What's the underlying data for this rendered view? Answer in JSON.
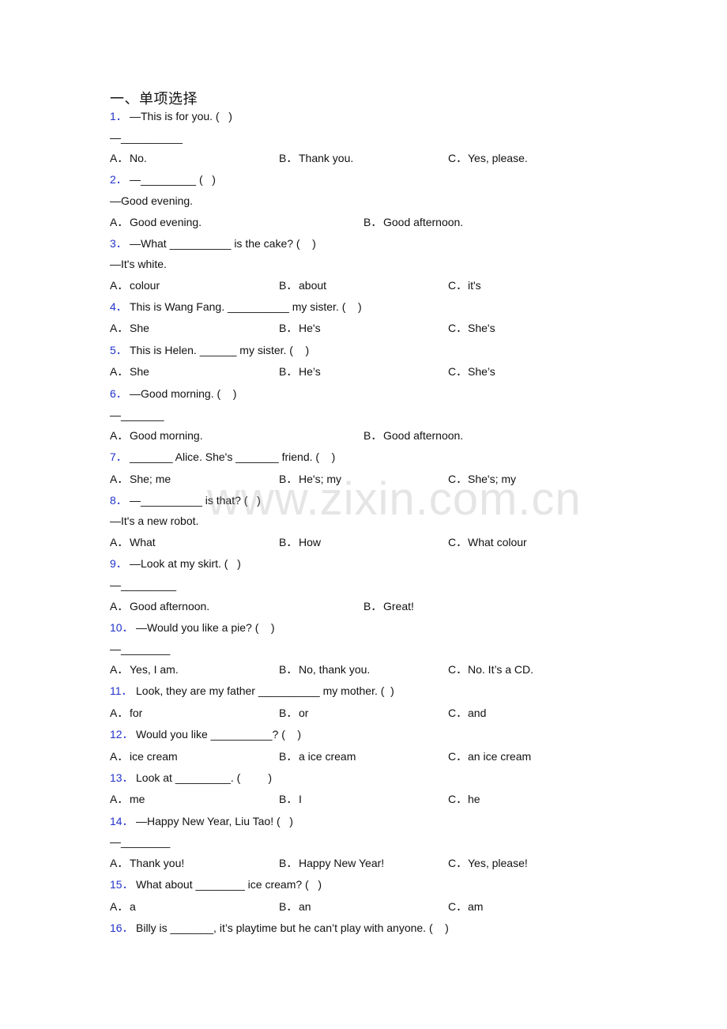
{
  "section_title": "一、单项选择",
  "watermark": "www.zixin.com.cn",
  "questions": [
    {
      "num": "1．",
      "stem": "—This is for you. (   )",
      "reply": "—__________",
      "options": [
        {
          "letter": "A．",
          "text": "No."
        },
        {
          "letter": "B．",
          "text": "Thank you."
        },
        {
          "letter": "C．",
          "text": "Yes, please."
        }
      ]
    },
    {
      "num": "2．",
      "stem": "—_________ (   )",
      "reply": "—Good evening.",
      "options": [
        {
          "letter": "A．",
          "text": "Good evening."
        },
        {
          "letter": "B．",
          "text": "Good afternoon."
        }
      ]
    },
    {
      "num": "3．",
      "stem": "—What __________ is the cake? (    )",
      "reply": "—It's white.",
      "options": [
        {
          "letter": "A．",
          "text": "colour"
        },
        {
          "letter": "B．",
          "text": "about"
        },
        {
          "letter": "C．",
          "text": "it's"
        }
      ]
    },
    {
      "num": "4．",
      "stem": "This is Wang Fang. __________ my sister. (    )",
      "options": [
        {
          "letter": "A．",
          "text": "She"
        },
        {
          "letter": "B．",
          "text": "He's"
        },
        {
          "letter": "C．",
          "text": "She's"
        }
      ]
    },
    {
      "num": "5．",
      "stem": "This is Helen. ______ my sister. (    )",
      "options": [
        {
          "letter": "A．",
          "text": "She"
        },
        {
          "letter": "B．",
          "text": "He’s"
        },
        {
          "letter": "C．",
          "text": "She’s"
        }
      ]
    },
    {
      "num": "6．",
      "stem": "—Good morning. (    )",
      "reply": "—_______",
      "options": [
        {
          "letter": "A．",
          "text": "Good morning."
        },
        {
          "letter": "B．",
          "text": "Good afternoon."
        }
      ]
    },
    {
      "num": "7．",
      "stem": "_______ Alice. She's _______ friend. (    )",
      "options": [
        {
          "letter": "A．",
          "text": "She; me"
        },
        {
          "letter": "B．",
          "text": "He's; my"
        },
        {
          "letter": "C．",
          "text": "She's; my"
        }
      ]
    },
    {
      "num": "8．",
      "stem": "—__________ is that? (   )",
      "reply": "—It's a new robot.",
      "options": [
        {
          "letter": "A．",
          "text": "What"
        },
        {
          "letter": "B．",
          "text": "How"
        },
        {
          "letter": "C．",
          "text": "What colour"
        }
      ]
    },
    {
      "num": "9．",
      "stem": "—Look at my skirt. (   )",
      "reply": "—_________",
      "options": [
        {
          "letter": "A．",
          "text": "Good afternoon."
        },
        {
          "letter": "B．",
          "text": "Great!"
        }
      ]
    },
    {
      "num": "10．",
      "stem": "—Would you like a pie? (    )",
      "reply": "—________",
      "options": [
        {
          "letter": "A．",
          "text": "Yes, I am."
        },
        {
          "letter": "B．",
          "text": "No, thank you."
        },
        {
          "letter": "C．",
          "text": "No. It’s a CD."
        }
      ]
    },
    {
      "num": "11．",
      "stem": "Look, they are my father __________ my mother. (  )",
      "options": [
        {
          "letter": "A．",
          "text": "for"
        },
        {
          "letter": "B．",
          "text": "or"
        },
        {
          "letter": "C．",
          "text": "and"
        }
      ]
    },
    {
      "num": "12．",
      "stem": "Would you like __________? (    )",
      "options": [
        {
          "letter": "A．",
          "text": "ice cream"
        },
        {
          "letter": "B．",
          "text": "a ice cream"
        },
        {
          "letter": "C．",
          "text": "an ice cream"
        }
      ]
    },
    {
      "num": "13．",
      "stem": "Look at _________. (         )",
      "options": [
        {
          "letter": "A．",
          "text": "me"
        },
        {
          "letter": "B．",
          "text": "I"
        },
        {
          "letter": "C．",
          "text": "he"
        }
      ]
    },
    {
      "num": "14．",
      "stem": "—Happy New Year, Liu Tao! (   )",
      "reply": "—________",
      "options": [
        {
          "letter": "A．",
          "text": "Thank you!"
        },
        {
          "letter": "B．",
          "text": "Happy New Year!"
        },
        {
          "letter": "C．",
          "text": "Yes, please!"
        }
      ]
    },
    {
      "num": "15．",
      "stem": "What about ________ ice cream? (   )",
      "options": [
        {
          "letter": "A．",
          "text": "a"
        },
        {
          "letter": "B．",
          "text": "an"
        },
        {
          "letter": "C．",
          "text": "am"
        }
      ]
    },
    {
      "num": "16．",
      "stem": "Billy is _______, it’s playtime but he can’t play with anyone. (    )"
    }
  ]
}
